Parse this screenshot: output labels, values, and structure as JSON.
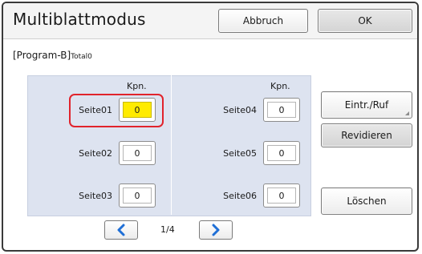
{
  "title": "Multiblattmodus",
  "buttons": {
    "cancel": "Abbruch",
    "ok": "OK",
    "entry_recall": "Eintr./Ruf",
    "revise": "Revidieren",
    "delete": "Löschen"
  },
  "program": {
    "name": "[Program-B]",
    "total": "Total0"
  },
  "grid": {
    "kpn_header": "Kpn.",
    "pages": [
      {
        "label": "Seite01",
        "value": "0",
        "selected": true
      },
      {
        "label": "Seite02",
        "value": "0",
        "selected": false
      },
      {
        "label": "Seite03",
        "value": "0",
        "selected": false
      },
      {
        "label": "Seite04",
        "value": "0",
        "selected": false
      },
      {
        "label": "Seite05",
        "value": "0",
        "selected": false
      },
      {
        "label": "Seite06",
        "value": "0",
        "selected": false
      }
    ]
  },
  "pagination": {
    "indicator": "1/4",
    "prev_icon": "chevron-left-icon",
    "next_icon": "chevron-right-icon"
  },
  "colors": {
    "accent_blue": "#1f6fd6",
    "highlight_red": "#e1232c",
    "selected_yellow": "#ffeb00",
    "panel_bg": "#dde3f0"
  }
}
